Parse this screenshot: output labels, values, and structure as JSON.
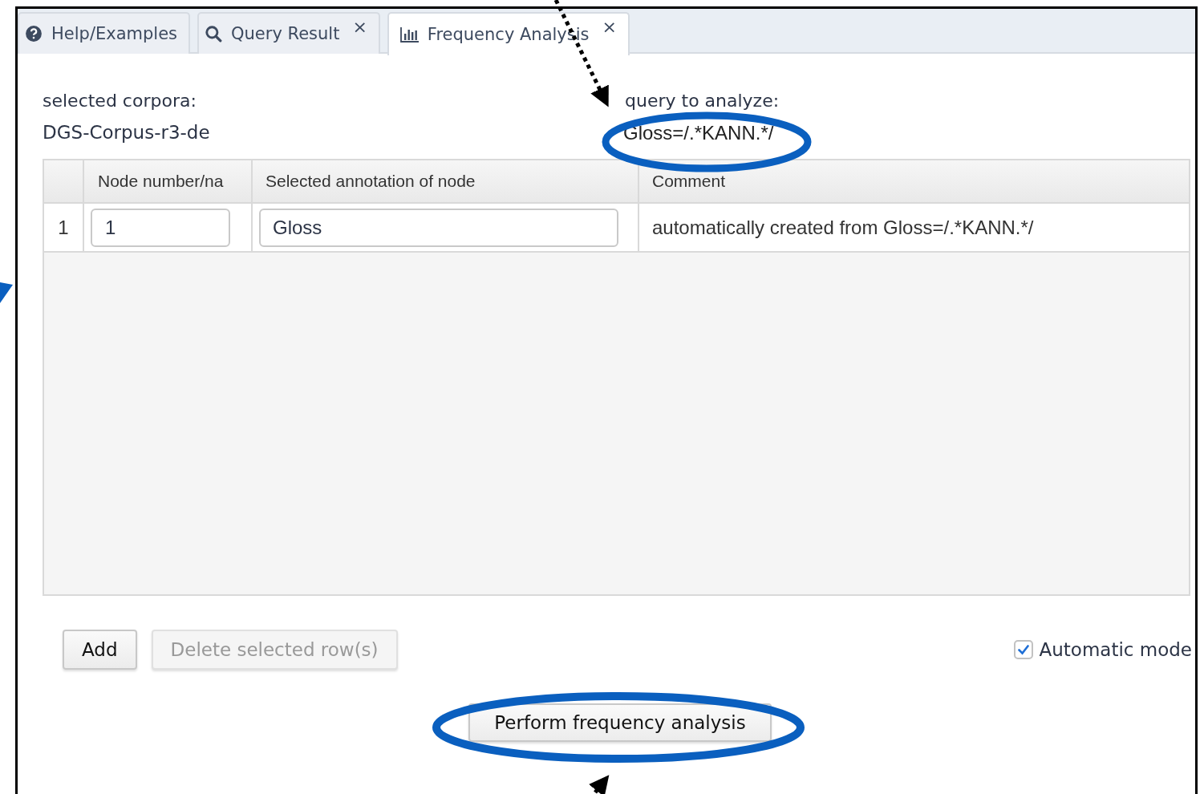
{
  "tabs": [
    {
      "kind": "help",
      "label": "Help/Examples",
      "closable": false,
      "selected": false
    },
    {
      "kind": "search",
      "label": "Query Result",
      "closable": true,
      "close": "×",
      "selected": false
    },
    {
      "kind": "chart",
      "label": "Frequency Analysis",
      "closable": true,
      "close": "×",
      "selected": true
    }
  ],
  "corpora": {
    "label": "selected corpora:",
    "value": "DGS-Corpus-r3-de"
  },
  "query": {
    "label": "query to analyze:",
    "value": "Gloss=/.*KANN.*/"
  },
  "table": {
    "columns": [
      "Node number/na",
      "Selected annotation of node",
      "Comment"
    ],
    "rows": [
      {
        "index": "1",
        "node": "1",
        "annotation": "Gloss",
        "comment": "automatically created from Gloss=/.*KANN.*/"
      }
    ]
  },
  "buttons": [
    {
      "label": "Add",
      "disabled": false
    },
    {
      "label": "Delete selected row(s)",
      "disabled": true
    }
  ],
  "automatic_mode": {
    "label": "Automatic mode",
    "checked": true
  },
  "perform_button": {
    "label": "Perform frequency analysis"
  }
}
